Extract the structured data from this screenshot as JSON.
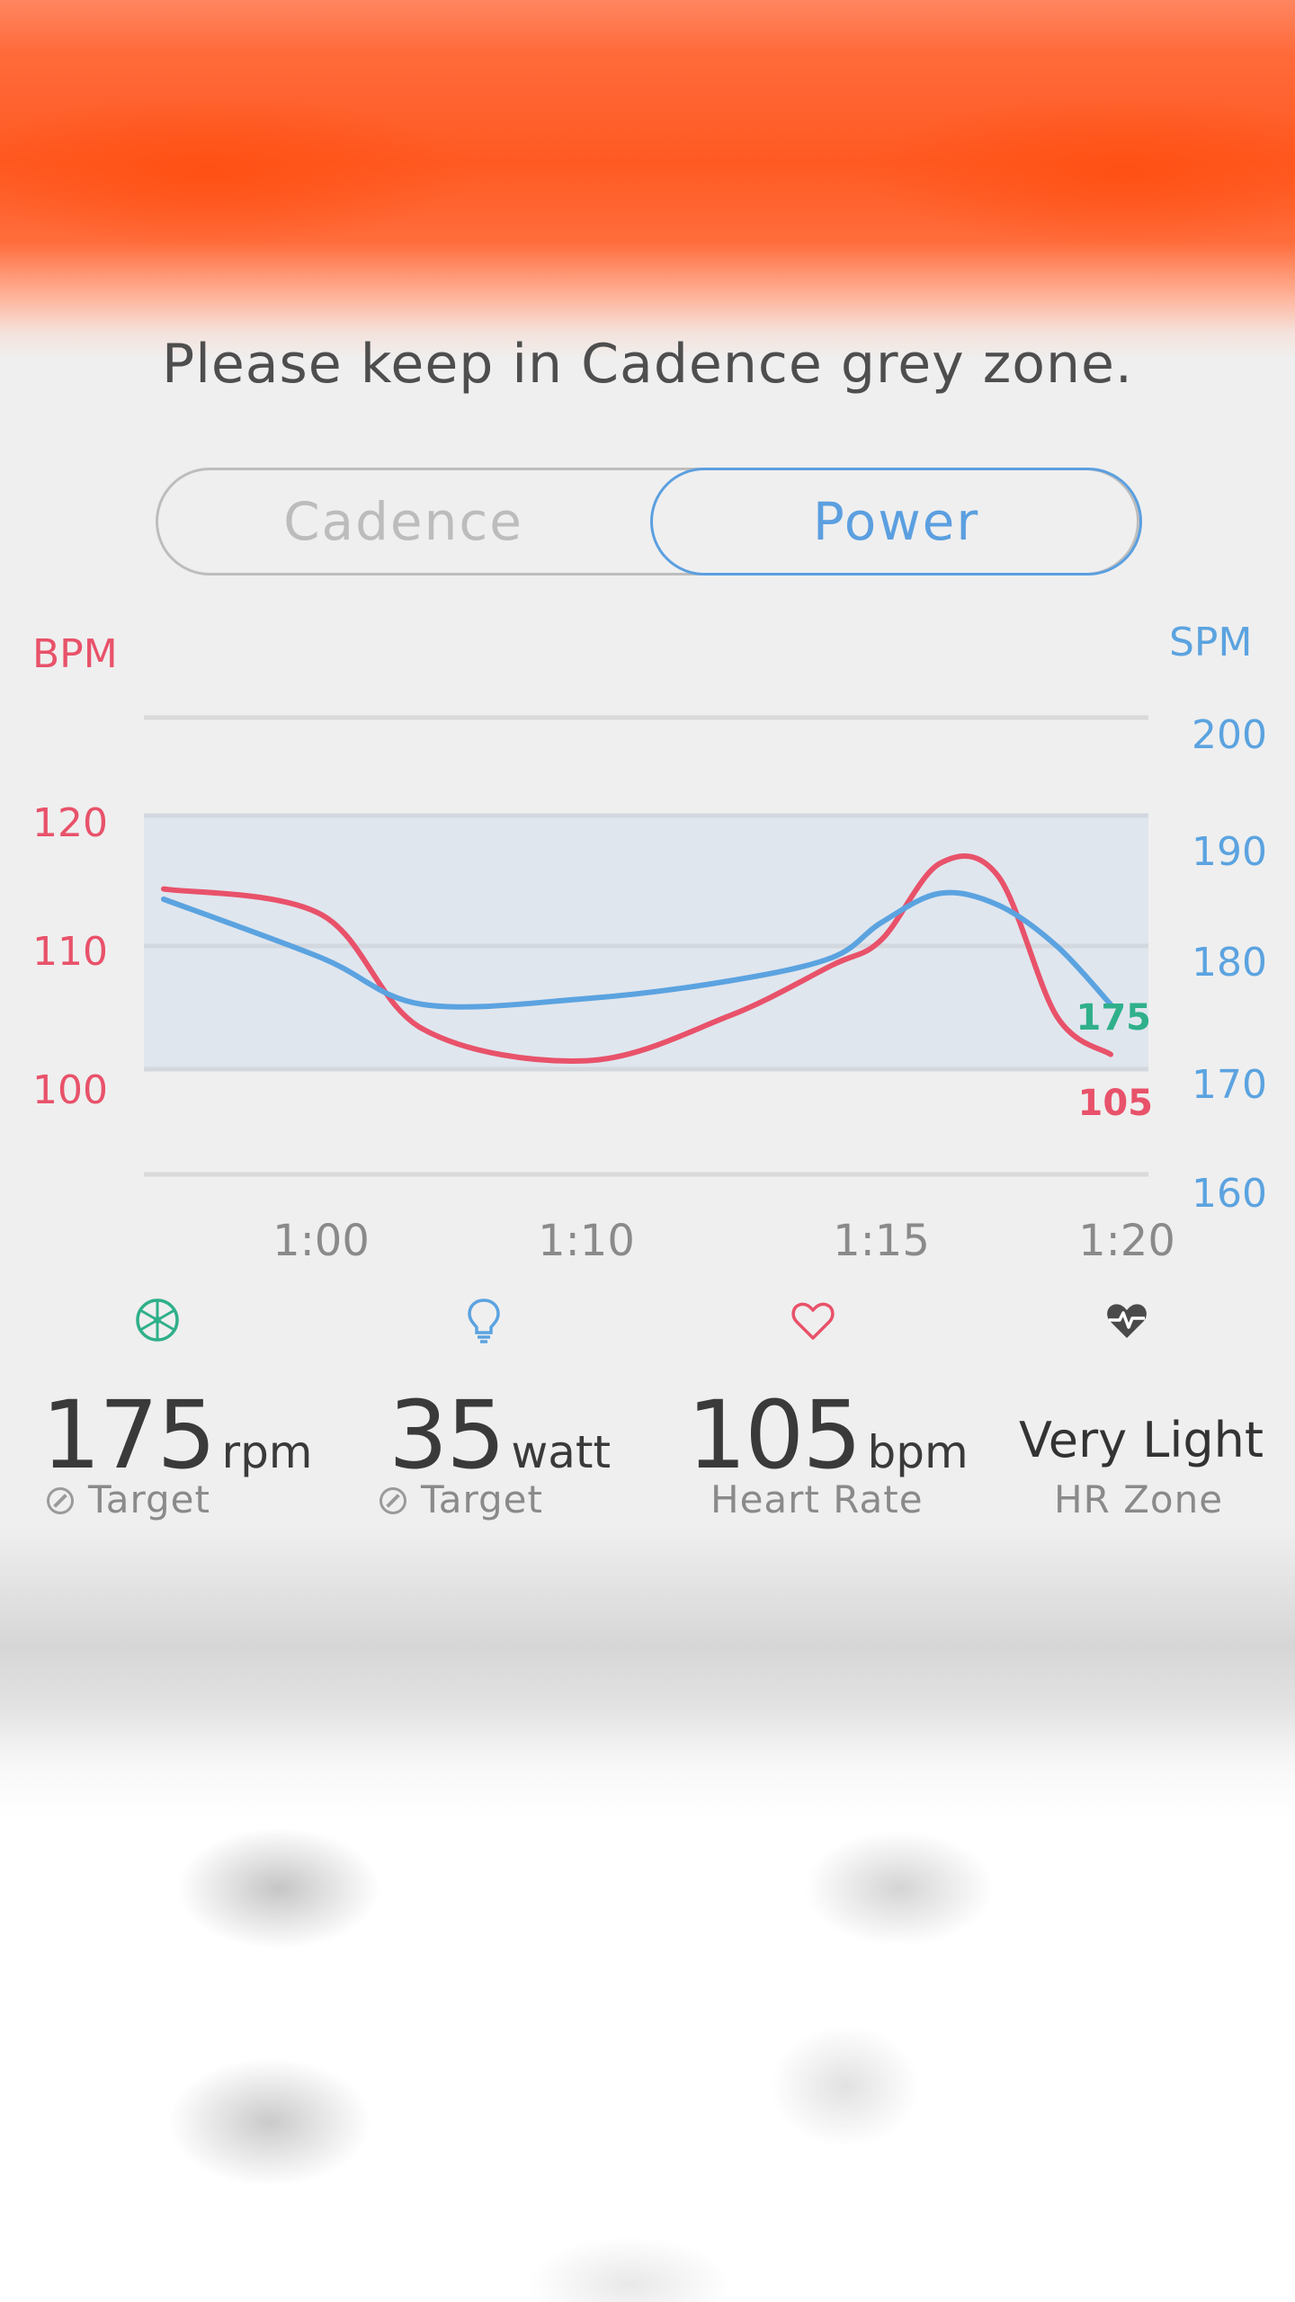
{
  "header": {
    "instruction": "Please keep in Cadence grey zone."
  },
  "toggle": {
    "options": [
      "Cadence",
      "Power"
    ],
    "selected": "Power"
  },
  "colors": {
    "heart_rate": "#e8526a",
    "cadence_line": "#5ba3e0",
    "cadence_value": "#2fb08a",
    "zone_band": "#e0e6ee",
    "accent_blue": "#5b9fe0"
  },
  "chart_data": {
    "type": "line",
    "left_axis_label": "BPM",
    "right_axis_label": "SPM",
    "left_ticks": [
      "120",
      "110",
      "100"
    ],
    "right_ticks": [
      "200",
      "190",
      "180",
      "170",
      "160"
    ],
    "x_ticks": [
      "1:00",
      "1:10",
      "1:15",
      "1:20"
    ],
    "zone_band_bpm": [
      100,
      120
    ],
    "series": [
      {
        "name": "",
        "axis": "left",
        "x": [
          "0:55",
          "1:00",
          "1:05",
          "1:10",
          "1:13",
          "1:15",
          "1:16",
          "1:17",
          "1:18",
          "1:19",
          "1:20"
        ],
        "values": [
          116,
          114,
          105,
          102.5,
          106,
          110,
          112,
          118,
          117,
          106,
          103
        ]
      },
      {
        "name": "",
        "axis": "right",
        "x": [
          "0:55",
          "1:00",
          "1:05",
          "1:10",
          "1:13",
          "1:15",
          "1:16",
          "1:17",
          "1:18",
          "1:19",
          "1:20"
        ],
        "values": [
          186,
          181,
          177,
          177.5,
          179,
          181,
          184,
          186.5,
          185.5,
          182,
          177
        ]
      }
    ],
    "end_labels": {
      "cadence": "175",
      "heart_rate": "105"
    }
  },
  "metrics": [
    {
      "icon": "wheel-icon",
      "value": "175",
      "unit": "rpm",
      "label": "Target",
      "editable": true
    },
    {
      "icon": "bulb-icon",
      "value": "35",
      "unit": "watt",
      "label": "Target",
      "editable": true
    },
    {
      "icon": "heart-icon",
      "value": "105",
      "unit": "bpm",
      "label": "Heart Rate",
      "editable": false
    },
    {
      "icon": "heart-pulse-icon",
      "value": "Very Light",
      "unit": "",
      "label": "HR Zone",
      "editable": false
    }
  ]
}
